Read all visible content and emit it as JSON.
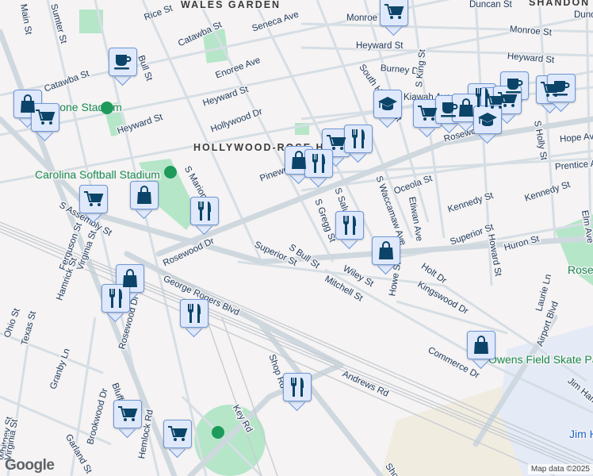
{
  "neighborhoods": [
    "WALES GARDEN",
    "HOLLYWOOD-ROSE HILL",
    "SHANDON"
  ],
  "streets": [
    "Main St",
    "Sumter St",
    "Rice St",
    "Catawba St",
    "Seneca Ave",
    "Bull St",
    "Enoree Ave",
    "Catawba St",
    "Heyward St",
    "Hollywood Dr",
    "Heyward St",
    "S Marion St",
    "Pinewood Dr",
    "S Assembly St",
    "Rosewood Dr",
    "Ferguson St",
    "Virginia St",
    "Hamrick St",
    "George Rogers Blvd",
    "Rosewood Dr",
    "Ohio St",
    "Texas St",
    "Whitney St",
    "Granby Ln",
    "Bluff Rd",
    "Virginia St",
    "Garland St",
    "Brookwood Dr",
    "Hemlock Rd",
    "Key Rd",
    "Shop Rd",
    "Shop Rd",
    "Andrews Rd",
    "Superior St",
    "S Bull St",
    "Mitchell St",
    "Wiley St",
    "S Gregg St",
    "S Saluda Ave",
    "S Waccamaw Ave",
    "Etiwan Ave",
    "Oceola St",
    "Kennedy St",
    "Kennedy St",
    "Superior St",
    "Huron St",
    "Holt Dr",
    "Howard St",
    "Howe St",
    "Kingswood Dr",
    "Commerce Dr",
    "Laurie Ln",
    "Airport Blvd",
    "Jim Hamilton Blvd",
    "Monroe St",
    "Monroe St",
    "Heyward St",
    "Heyward St",
    "Burney Dr",
    "South Harden St",
    "S King St",
    "Kiawah Ave",
    "Rosewood Dr",
    "S Holly St",
    "Hope Ave",
    "Prentice Ave",
    "Elm Ave",
    "Duncan St",
    "Duncan St"
  ],
  "places": [
    "Carolina Softball Stadium",
    "Stone Stadium",
    "Owens Field Skate Park",
    "Rosewood Park",
    "Jim Hamilton - L.B. Owens Airport"
  ],
  "markers": [
    "coffee",
    "shopping",
    "grocery",
    "grocery",
    "shopping",
    "restaurant",
    "shopping",
    "restaurant",
    "restaurant",
    "grocery",
    "grocery",
    "restaurant",
    "grocery",
    "school",
    "grocery",
    "coffee",
    "restaurant",
    "shopping",
    "grocery",
    "coffee",
    "grocery",
    "school",
    "grocery",
    "coffee",
    "shopping",
    "grocery",
    "restaurant",
    "restaurant",
    "restaurant",
    "shopping",
    "shopping"
  ],
  "attribution": {
    "logo": "Google",
    "copyright": "Map data ©2025"
  },
  "colors": {
    "marker_icon": "#0b4468",
    "marker_bg": "#dfe9fb",
    "park": "#a8e0bf",
    "road": "#d6dee5"
  }
}
